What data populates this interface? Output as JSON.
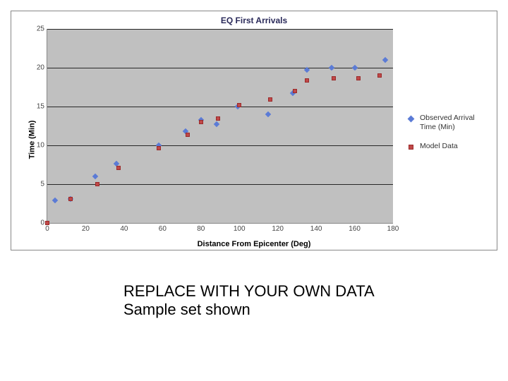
{
  "chart_data": {
    "type": "scatter",
    "title": "EQ First Arrivals",
    "xlabel": "Distance From Epicenter (Deg)",
    "ylabel": "Time (Min)",
    "xlim": [
      0,
      180
    ],
    "ylim": [
      0,
      25
    ],
    "xticks": [
      0,
      20,
      40,
      60,
      80,
      100,
      120,
      140,
      160,
      180
    ],
    "yticks": [
      0,
      5,
      10,
      15,
      20,
      25
    ],
    "series": [
      {
        "name": "Observed Arrival Time (Min)",
        "marker": "diamond",
        "color": "#5b7bd6",
        "points": [
          {
            "x": 4,
            "y": 2.9
          },
          {
            "x": 12,
            "y": 3.1
          },
          {
            "x": 25,
            "y": 6.0
          },
          {
            "x": 36,
            "y": 7.6
          },
          {
            "x": 58,
            "y": 10.0
          },
          {
            "x": 72,
            "y": 11.8
          },
          {
            "x": 80,
            "y": 13.3
          },
          {
            "x": 88,
            "y": 12.7
          },
          {
            "x": 99,
            "y": 15.0
          },
          {
            "x": 115,
            "y": 14.0
          },
          {
            "x": 128,
            "y": 16.7
          },
          {
            "x": 135,
            "y": 19.7
          },
          {
            "x": 148,
            "y": 20.0
          },
          {
            "x": 160,
            "y": 20.0
          },
          {
            "x": 176,
            "y": 21.0
          }
        ]
      },
      {
        "name": "Model Data",
        "marker": "square",
        "color": "#c04848",
        "points": [
          {
            "x": 0,
            "y": 0.0
          },
          {
            "x": 12,
            "y": 3.1
          },
          {
            "x": 26,
            "y": 5.0
          },
          {
            "x": 37,
            "y": 7.1
          },
          {
            "x": 58,
            "y": 9.6
          },
          {
            "x": 73,
            "y": 11.4
          },
          {
            "x": 80,
            "y": 13.0
          },
          {
            "x": 89,
            "y": 13.5
          },
          {
            "x": 100,
            "y": 15.2
          },
          {
            "x": 116,
            "y": 15.9
          },
          {
            "x": 129,
            "y": 17.0
          },
          {
            "x": 135,
            "y": 18.4
          },
          {
            "x": 149,
            "y": 18.6
          },
          {
            "x": 162,
            "y": 18.6
          },
          {
            "x": 173,
            "y": 19.0
          }
        ]
      }
    ]
  },
  "caption": {
    "line1": "REPLACE WITH YOUR OWN DATA",
    "line2": "Sample set shown"
  }
}
